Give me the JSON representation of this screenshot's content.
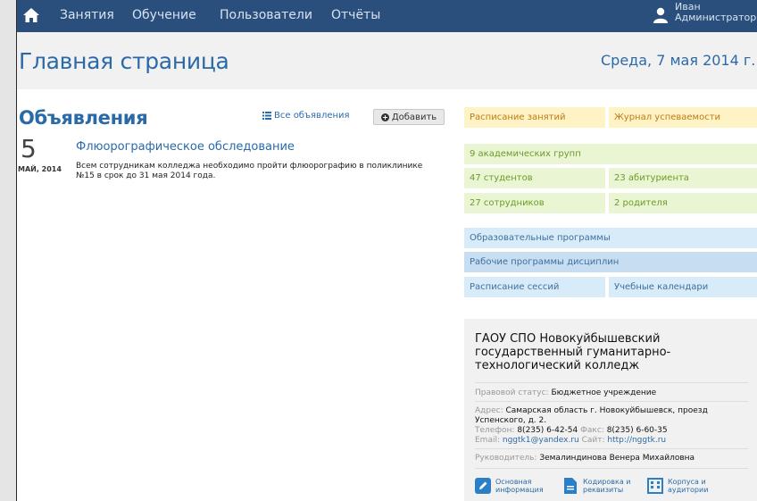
{
  "nav": {
    "items": [
      "Занятия",
      "Обучение",
      "Пользователи",
      "Отчёты"
    ],
    "user": {
      "first_name": "Иван",
      "role": "Администратор"
    }
  },
  "header": {
    "title": "Главная страница",
    "date": "Среда, 7 мая 2014 г."
  },
  "announcements": {
    "title": "Объявления",
    "all_label": "Все объявления",
    "add_label": "Добавить",
    "items": [
      {
        "day": "5",
        "month_year": "МАЙ, 2014",
        "heading": "Флюорографическое обследование",
        "text": "Всем сотрудникам колледжа необходимо пройти флюорографию в поликлинике №15 в срок до 31 мая 2014 года."
      }
    ]
  },
  "tiles": {
    "schedule": "Расписание занятий",
    "journal": "Журнал успеваемости",
    "groups": "9 академических групп",
    "students": "47 студентов",
    "applicants": "23 абитуриента",
    "staff": "27 сотрудников",
    "parents": "2 родителя",
    "programs": "Образовательные программы",
    "work_programs": "Рабочие программы дисциплин",
    "sessions": "Расписание сессий",
    "calendars": "Учебные календари"
  },
  "info": {
    "org_name": "ГАОУ СПО Новокуйбышевский государственный гуманитарно-технологический колледж",
    "status_label": "Правовой статус:",
    "status_value": "Бюджетное учреждение",
    "address_label": "Адрес:",
    "address_value": "Самарская область г. Новокуйбышевск, проезд Успенского, д. 2.",
    "phone_label": "Телефон:",
    "phone_value": "8(235) 6-42-54",
    "fax_label": "Факс:",
    "fax_value": "8(235) 6-60-35",
    "email_label": "Email:",
    "email_value": "nggtk1@yandex.ru",
    "site_label": "Сайт:",
    "site_value": "http://nggtk.ru",
    "head_label": "Руководитель:",
    "head_value": "Земалиндинова Венера Михайловна",
    "footer_links": [
      {
        "line1": "Основная",
        "line2": "информация"
      },
      {
        "line1": "Кодировка и",
        "line2": "реквизиты"
      },
      {
        "line1": "Корпуса и",
        "line2": "аудитории"
      }
    ]
  },
  "colors": {
    "nav_bg": "#2b4f7d",
    "accent": "#2b6aa8",
    "tile_yellow": "#fdf3c5",
    "tile_green": "#eaf5d4",
    "tile_blue": "#d8ebf8"
  },
  "icons": [
    "home-icon",
    "user-icon",
    "list-icon",
    "plus-circle-icon",
    "edit-icon",
    "document-icon",
    "building-icon"
  ]
}
